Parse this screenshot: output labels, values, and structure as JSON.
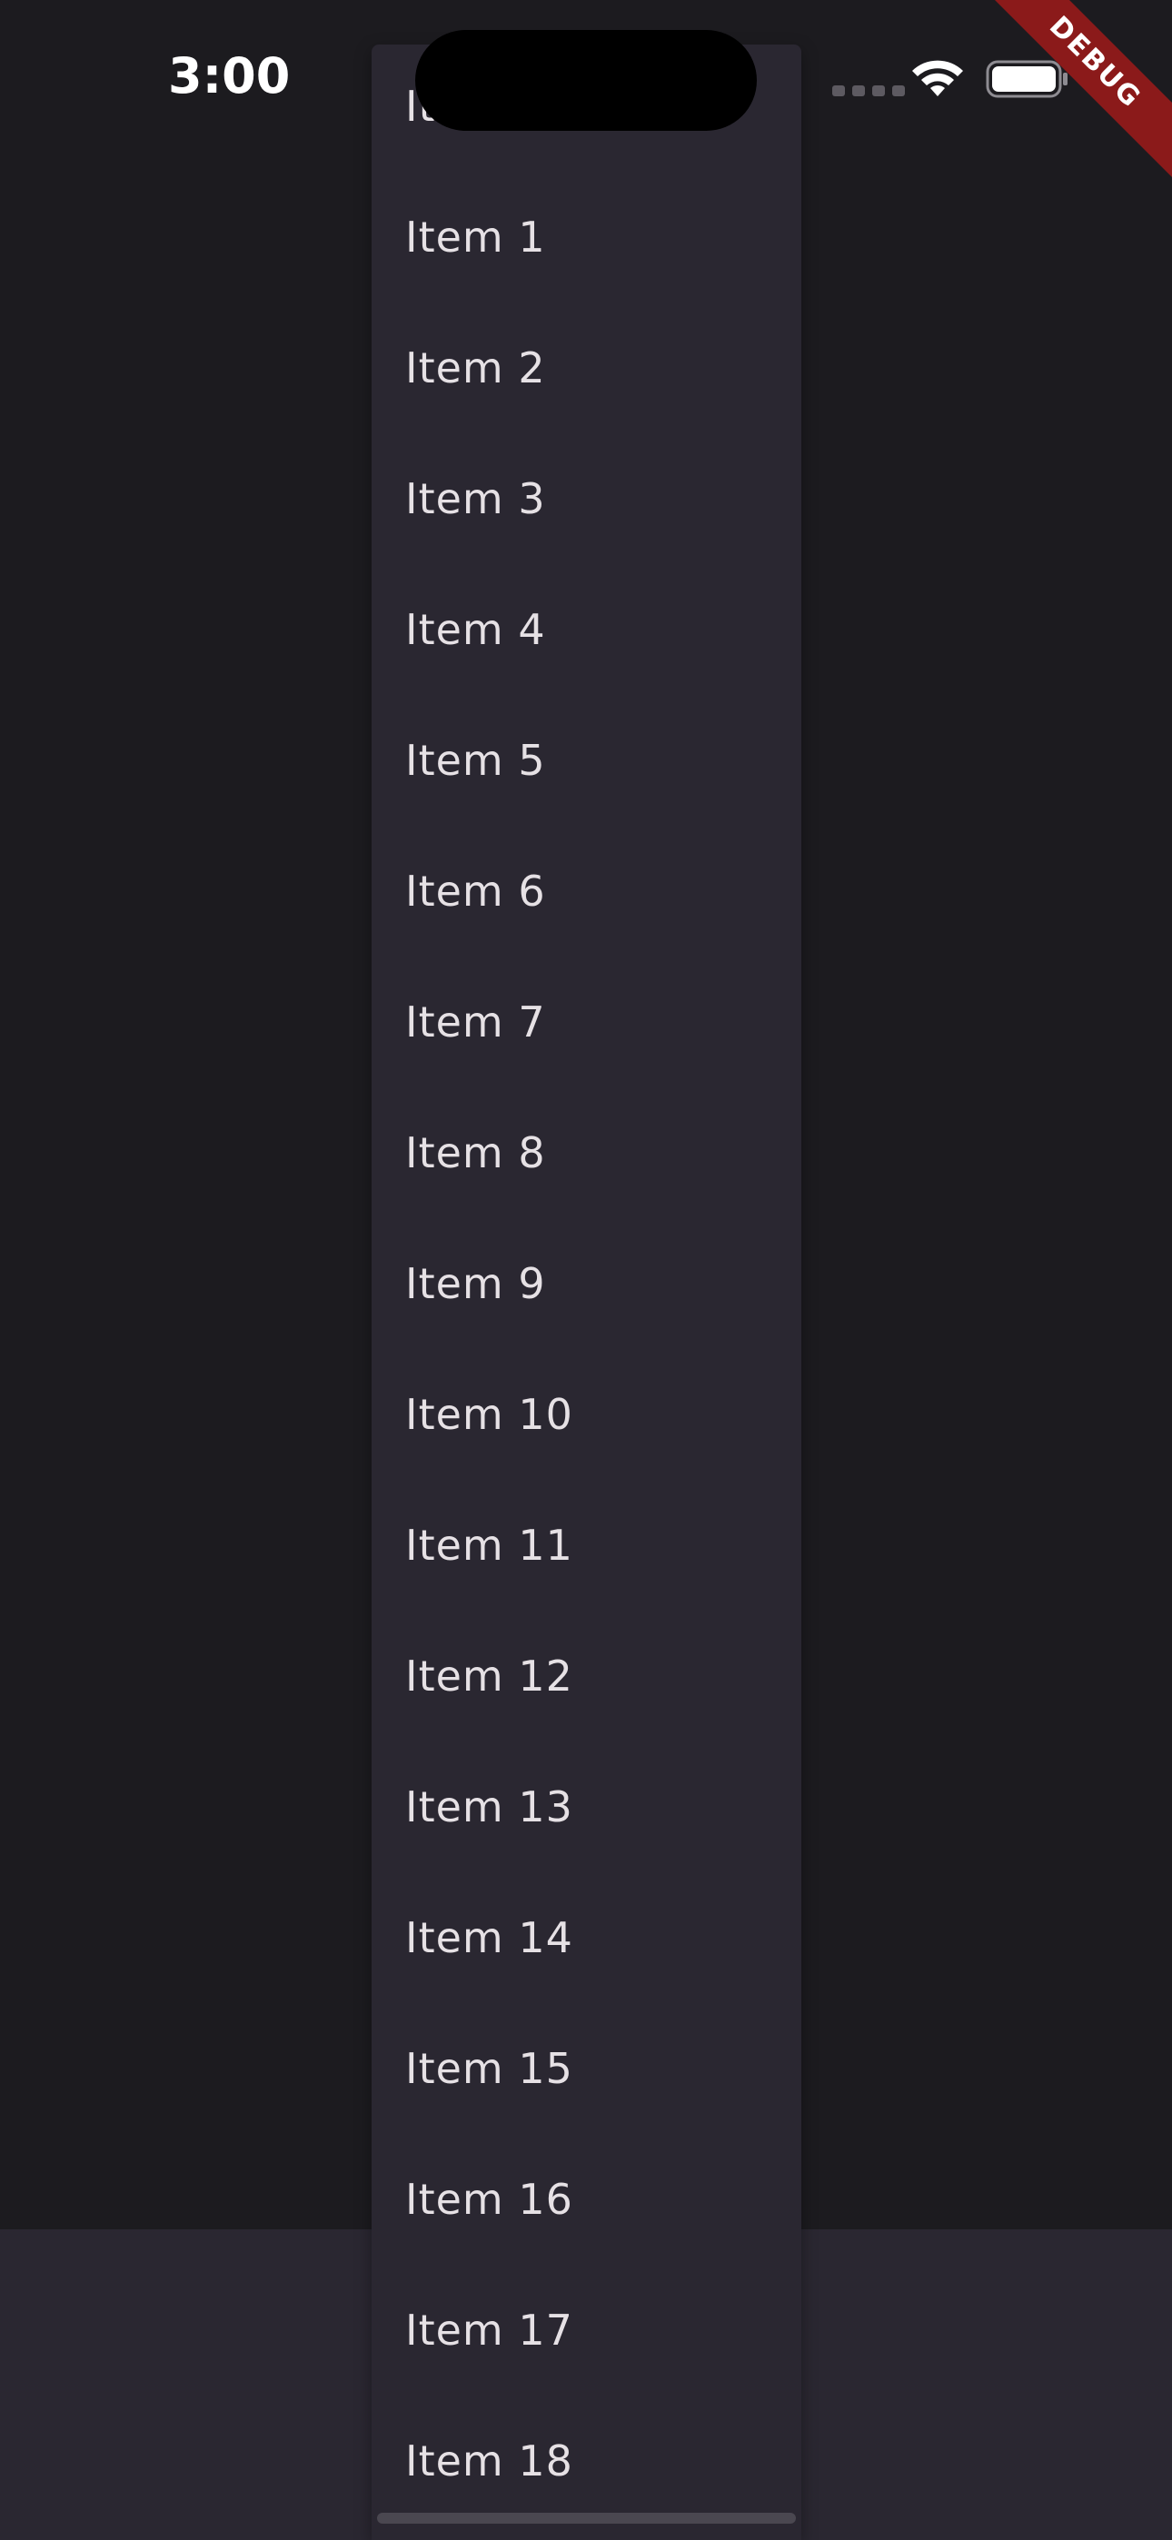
{
  "status_bar": {
    "time": "3:00"
  },
  "debug_banner": {
    "label": "DEBUG",
    "color": "#8b1a1a"
  },
  "dropdown_menu": {
    "items": [
      "Item 0",
      "Item 1",
      "Item 2",
      "Item 3",
      "Item 4",
      "Item 5",
      "Item 6",
      "Item 7",
      "Item 8",
      "Item 9",
      "Item 10",
      "Item 11",
      "Item 12",
      "Item 13",
      "Item 14",
      "Item 15",
      "Item 16",
      "Item 17",
      "Item 18"
    ]
  },
  "colors": {
    "background": "#1c1b1f",
    "surface": "#2a2731",
    "text": "#e6e1e5"
  }
}
